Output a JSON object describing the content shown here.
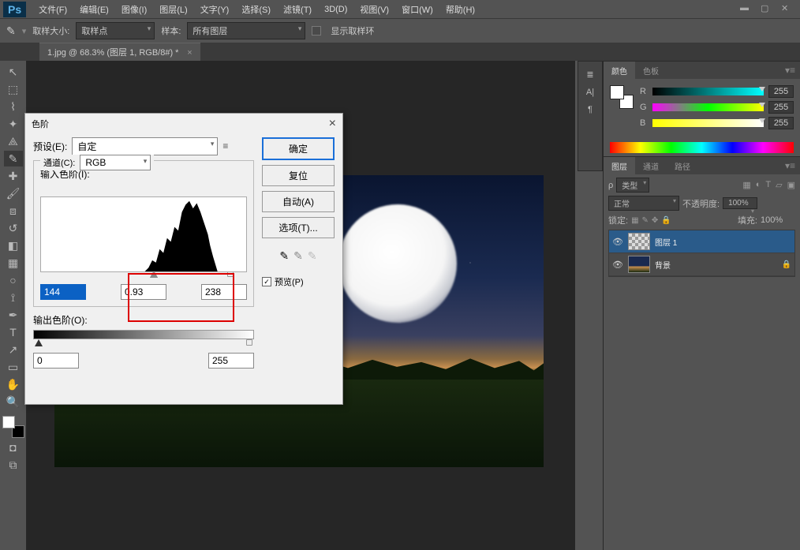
{
  "app": {
    "logo": "Ps"
  },
  "menu": [
    "文件(F)",
    "编辑(E)",
    "图像(I)",
    "图层(L)",
    "文字(Y)",
    "选择(S)",
    "滤镜(T)",
    "3D(D)",
    "视图(V)",
    "窗口(W)",
    "帮助(H)"
  ],
  "options": {
    "sample_size_label": "取样大小:",
    "sample_size_value": "取样点",
    "sample_label": "样本:",
    "sample_value": "所有图层",
    "show_ring": "显示取样环"
  },
  "doc_tab": "1.jpg @ 68.3% (图层 1, RGB/8#) *",
  "dialog": {
    "title": "色阶",
    "preset_label": "预设(E):",
    "preset_value": "自定",
    "channel_label": "通道(C):",
    "channel_value": "RGB",
    "input_label": "输入色阶(I):",
    "shadow": "144",
    "mid": "0.93",
    "highlight": "238",
    "output_label": "输出色阶(O):",
    "out_lo": "0",
    "out_hi": "255",
    "ok": "确定",
    "reset": "复位",
    "auto": "自动(A)",
    "options": "选项(T)...",
    "preview": "预览(P)"
  },
  "color_panel": {
    "tab1": "颜色",
    "tab2": "色板",
    "r": "R",
    "g": "G",
    "b": "B",
    "rv": "255",
    "gv": "255",
    "bv": "255"
  },
  "layers_panel": {
    "tab1": "图层",
    "tab2": "通道",
    "tab3": "路径",
    "kind": "类型",
    "blend": "正常",
    "opacity_label": "不透明度:",
    "opacity": "100%",
    "lock_label": "锁定:",
    "fill_label": "填充:",
    "fill": "100%",
    "layer1": "图层 1",
    "background": "背景"
  }
}
